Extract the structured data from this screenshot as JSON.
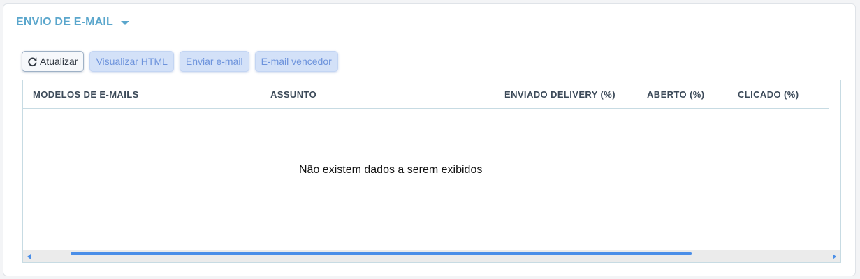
{
  "section": {
    "title": "ENVIO DE E-MAIL",
    "toggle_icon": "chevron-down-icon"
  },
  "toolbar": {
    "refresh": {
      "label": "Atualizar",
      "icon": "refresh-icon"
    },
    "view_html": {
      "label": "Visualizar HTML"
    },
    "send_email": {
      "label": "Enviar e-mail"
    },
    "winner_email": {
      "label": "E-mail vencedor"
    }
  },
  "table": {
    "columns": [
      "MODELOS DE E-MAILS",
      "ASSUNTO",
      "ENVIADO DELIVERY (%)",
      "ABERTO (%)",
      "CLICADO (%)"
    ],
    "rows": [],
    "empty_message": "Não existem dados a serem exibidos"
  },
  "colors": {
    "accent": "#5aa6cc",
    "action_button_bg": "#d3e1f8",
    "action_button_text": "#6d93dc",
    "scrollbar_thumb": "#4a8ee8"
  }
}
